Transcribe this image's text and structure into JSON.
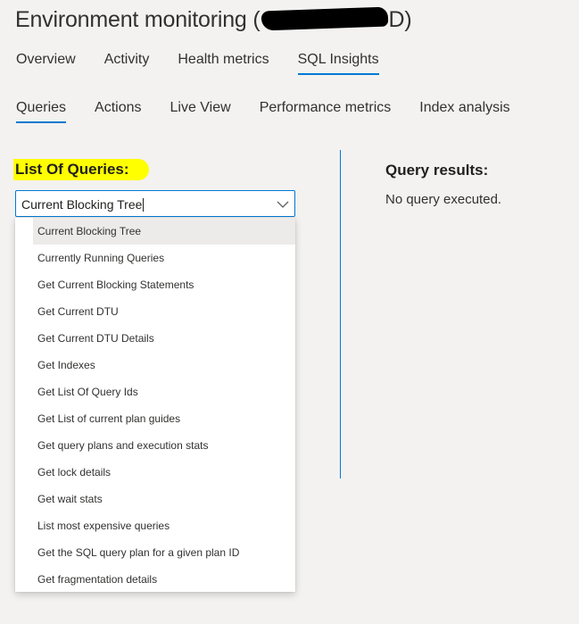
{
  "header": {
    "title_prefix": "Environment monitoring (",
    "title_suffix": "D)"
  },
  "main_tabs": [
    {
      "label": "Overview",
      "active": false
    },
    {
      "label": "Activity",
      "active": false
    },
    {
      "label": "Health metrics",
      "active": false
    },
    {
      "label": "SQL Insights",
      "active": true
    }
  ],
  "sub_tabs": [
    {
      "label": "Queries",
      "active": true
    },
    {
      "label": "Actions",
      "active": false
    },
    {
      "label": "Live View",
      "active": false
    },
    {
      "label": "Performance metrics",
      "active": false
    },
    {
      "label": "Index analysis",
      "active": false
    }
  ],
  "queries": {
    "label": "List Of Queries:",
    "selected": "Current Blocking Tree",
    "options": [
      "Current Blocking Tree",
      "Currently Running Queries",
      "Get Current Blocking Statements",
      "Get Current DTU",
      "Get Current DTU Details",
      "Get Indexes",
      "Get List Of Query Ids",
      "Get List of current plan guides",
      "Get query plans and execution stats",
      "Get lock details",
      "Get wait stats",
      "List most expensive queries",
      "Get the SQL query plan for a given plan ID",
      "Get fragmentation details"
    ]
  },
  "results": {
    "title": "Query results:",
    "message": "No query executed."
  },
  "colors": {
    "accent": "#0078d4",
    "highlight": "#ffff00",
    "background": "#f3f2f1",
    "selected_item": "#edebe9"
  },
  "icons": {
    "dropdown": "chevron-down-icon"
  }
}
